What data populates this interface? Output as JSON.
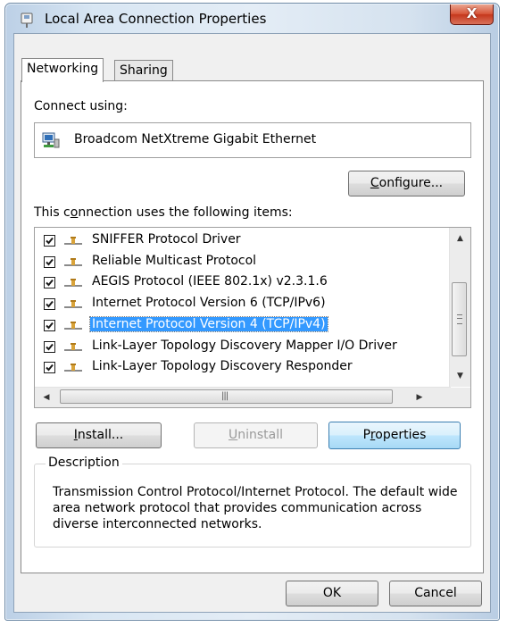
{
  "window": {
    "title": "Local Area Connection Properties",
    "close_label": "X"
  },
  "tabs": [
    {
      "label": "Networking",
      "active": true
    },
    {
      "label": "Sharing",
      "active": false
    }
  ],
  "connect_using": {
    "label": "Connect using:",
    "adapter": "Broadcom NetXtreme Gigabit Ethernet"
  },
  "buttons": {
    "configure": {
      "pre": "",
      "key": "C",
      "post": "onfigure..."
    },
    "install": {
      "pre": "",
      "key": "I",
      "post": "nstall..."
    },
    "uninstall": {
      "pre": "",
      "key": "U",
      "post": "ninstall"
    },
    "properties": {
      "pre": "P",
      "key": "r",
      "post": "operties"
    },
    "ok": "OK",
    "cancel": "Cancel"
  },
  "items_label": {
    "pre": "This c",
    "key": "o",
    "post": "nnection uses the following items:"
  },
  "items": [
    {
      "label": "SNIFFER Protocol Driver",
      "checked": true,
      "selected": false
    },
    {
      "label": "Reliable Multicast Protocol",
      "checked": true,
      "selected": false
    },
    {
      "label": "AEGIS Protocol (IEEE 802.1x) v2.3.1.6",
      "checked": true,
      "selected": false
    },
    {
      "label": "Internet Protocol Version 6 (TCP/IPv6)",
      "checked": true,
      "selected": false
    },
    {
      "label": "Internet Protocol Version 4 (TCP/IPv4)",
      "checked": true,
      "selected": true
    },
    {
      "label": "Link-Layer Topology Discovery Mapper I/O Driver",
      "checked": true,
      "selected": false
    },
    {
      "label": "Link-Layer Topology Discovery Responder",
      "checked": true,
      "selected": false
    }
  ],
  "description": {
    "legend": "Description",
    "text": "Transmission Control Protocol/Internet Protocol. The default wide area network protocol that provides communication across diverse interconnected networks."
  },
  "icons": {
    "title": "network-connection-icon",
    "adapter": "network-adapter-icon",
    "protocol": "protocol-icon",
    "checkbox": "checkmark-icon"
  },
  "colors": {
    "selection": "#3399ff",
    "close_button": "#c5371c",
    "focused_button": "#bee6fd"
  }
}
